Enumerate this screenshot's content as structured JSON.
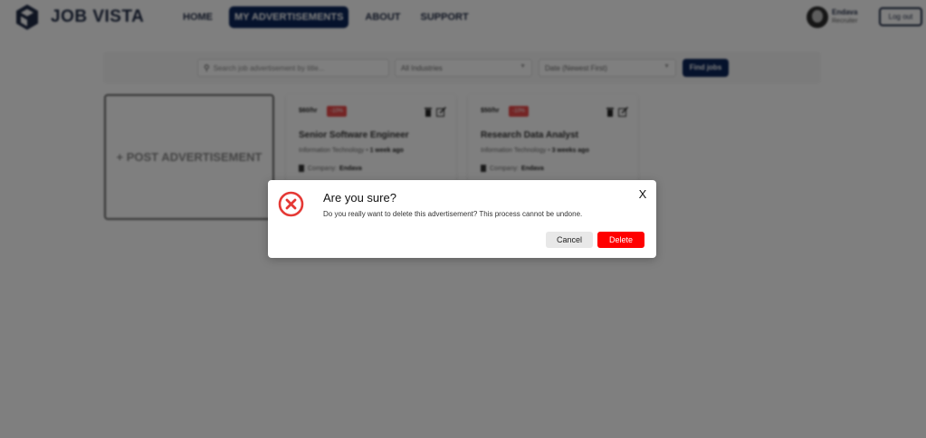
{
  "header": {
    "brand": "JOB VISTA",
    "nav": [
      {
        "label": "HOME"
      },
      {
        "label": "MY ADVERTISEMENTS"
      },
      {
        "label": "ABOUT"
      },
      {
        "label": "SUPPORT"
      }
    ],
    "user": {
      "name": "Endava",
      "role": "Recruiter"
    },
    "logout_label": "Log out"
  },
  "filters": {
    "search_placeholder": "Search job advertisement by title...",
    "industry_value": "All Industries",
    "date_value": "Date (Newest First)",
    "find_label": "Find jobs"
  },
  "post_card": {
    "label": "+ POST ADVERTISEMENT"
  },
  "ads": [
    {
      "rate": "$60/hr",
      "badge": "-10%",
      "title": "Senior Software Engineer",
      "industry": "Information Technology",
      "age": "1 week ago",
      "company_label": "Company:",
      "company": "Endava"
    },
    {
      "rate": "$50/hr",
      "badge": "-10%",
      "title": "Research Data Analyst",
      "industry": "Information Technology",
      "age": "3 weeks ago",
      "company_label": "Company:",
      "company": "Endava"
    }
  ],
  "modal": {
    "title": "Are you sure?",
    "message": "Do you really want to delete this advertisement? This process cannot be undone.",
    "close_label": "X",
    "cancel_label": "Cancel",
    "delete_label": "Delete"
  },
  "colors": {
    "brand_navy": "#0b2559",
    "danger_red": "#ff0000",
    "icon_red": "#e53935",
    "overlay": "rgba(0,0,0,0.5)"
  },
  "icons": [
    "logo-mark",
    "search-icon",
    "chevron-down-icon",
    "trash-icon",
    "edit-icon",
    "building-icon",
    "error-circle-icon",
    "close-icon"
  ]
}
